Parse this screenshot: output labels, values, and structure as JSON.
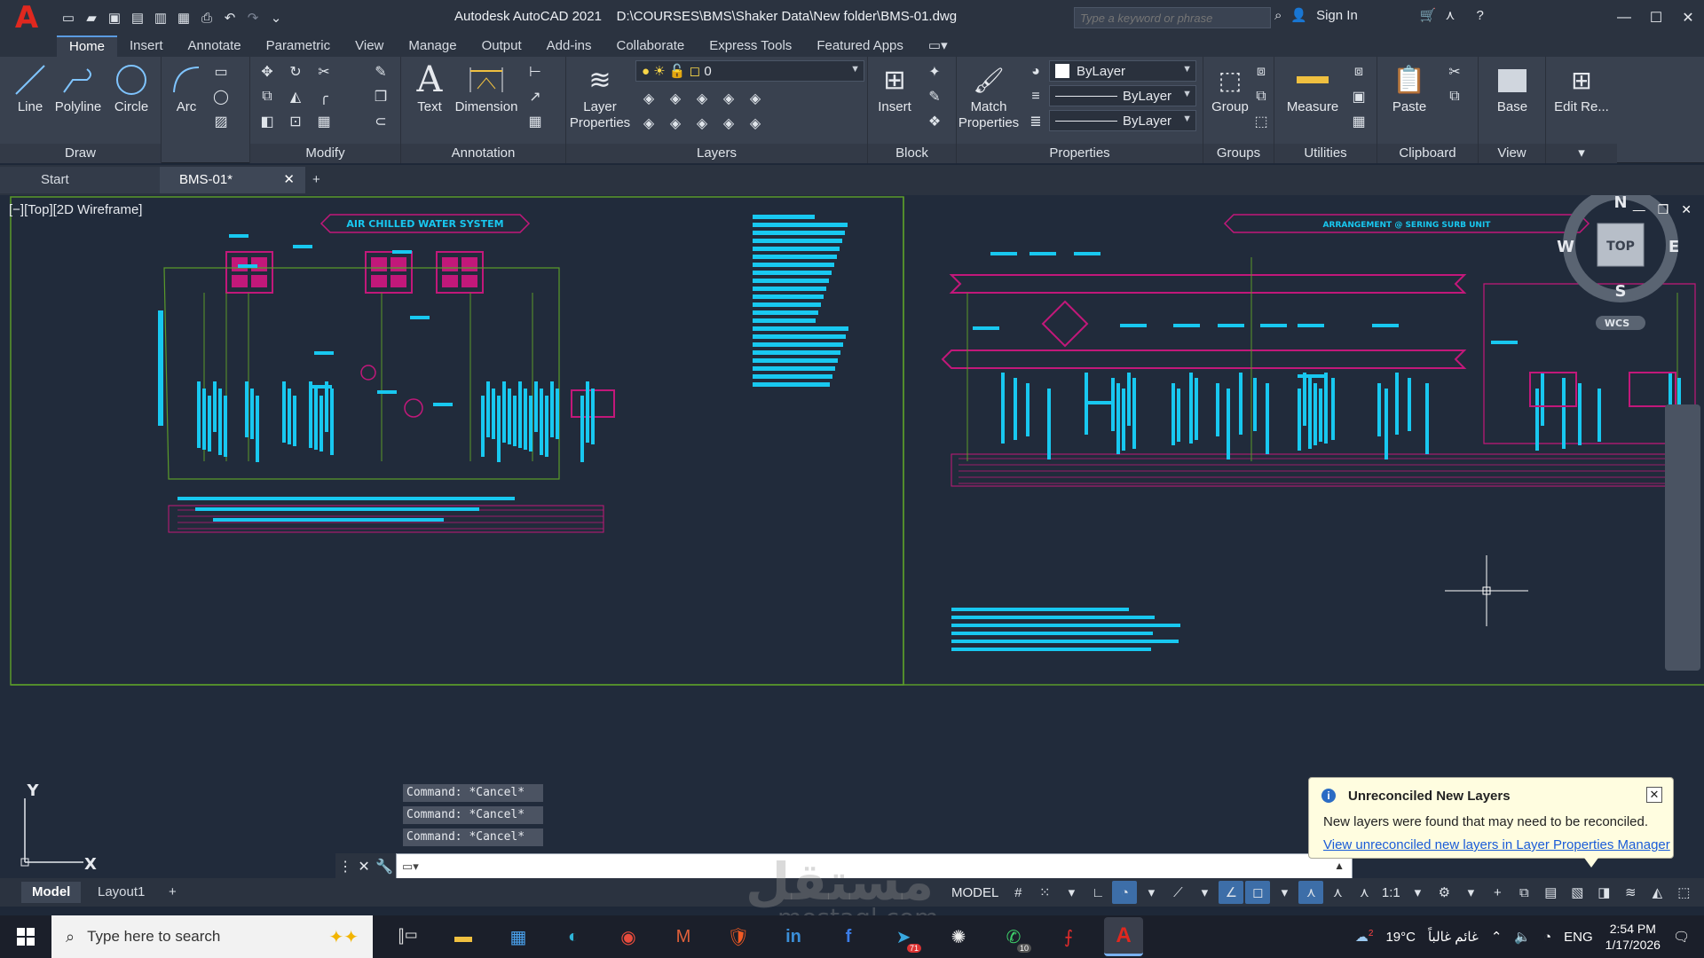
{
  "titlebar": {
    "app_title": "Autodesk AutoCAD 2021",
    "file_path": "D:\\COURSES\\BMS\\Shaker Data\\New folder\\BMS-01.dwg",
    "search_placeholder": "Type a keyword or phrase",
    "sign_in": "Sign In",
    "qat_icons": [
      "new-icon",
      "open-icon",
      "save-icon",
      "save-as-icon",
      "open-web-icon",
      "save-web-icon",
      "plot-icon",
      "undo-icon",
      "redo-icon"
    ]
  },
  "ribbon_tabs": [
    "Home",
    "Insert",
    "Annotate",
    "Parametric",
    "View",
    "Manage",
    "Output",
    "Add-ins",
    "Collaborate",
    "Express Tools",
    "Featured Apps"
  ],
  "ribbon": {
    "draw": {
      "title": "Draw",
      "tools": [
        "Line",
        "Polyline",
        "Circle",
        "Arc"
      ]
    },
    "modify": {
      "title": "Modify"
    },
    "annotation": {
      "title": "Annotation",
      "tools": [
        "Text",
        "Dimension"
      ]
    },
    "layers": {
      "title": "Layers",
      "tool": "Layer Properties",
      "current_layer": "0"
    },
    "block": {
      "title": "Block",
      "tool": "Insert"
    },
    "properties": {
      "title": "Properties",
      "tool": "Match Properties",
      "color": "ByLayer",
      "linetype": "ByLayer",
      "lineweight": "ByLayer"
    },
    "groups": {
      "title": "Groups",
      "tool": "Group"
    },
    "utilities": {
      "title": "Utilities",
      "tool": "Measure"
    },
    "clipboard": {
      "title": "Clipboard",
      "tool": "Paste"
    },
    "view": {
      "title": "View",
      "tool": "Base"
    },
    "edit_ref": {
      "tool": "Edit Re..."
    }
  },
  "file_tabs": {
    "start": "Start",
    "active": "BMS-01*"
  },
  "viewport": {
    "label": "[−][Top][2D Wireframe]",
    "left_title": "AIR CHILLED WATER SYSTEM",
    "right_title": "ARRANGEMENT @ SERING SURB UNIT",
    "viewcube": {
      "top": "TOP",
      "n": "N",
      "s": "S",
      "e": "E",
      "w": "W",
      "wcs": "WCS"
    },
    "ucs": {
      "x": "X",
      "y": "Y"
    }
  },
  "command": {
    "history": [
      "Command: *Cancel*",
      "Command: *Cancel*",
      "Command: *Cancel*"
    ],
    "input_value": ""
  },
  "notification": {
    "title": "Unreconciled New Layers",
    "message": "New layers were found that may need to be reconciled.",
    "link": "View unreconciled new layers in Layer Properties Manager"
  },
  "layout_tabs": [
    "Model",
    "Layout1"
  ],
  "status": {
    "model": "MODEL",
    "scale": "1:1"
  },
  "taskbar": {
    "search_placeholder": "Type here to search",
    "weather": "19°C",
    "weather_text": "غائم غالباً",
    "weather_badge": "2",
    "lang": "ENG",
    "time": "2:54 PM",
    "date": "1/17/2026",
    "telegram_badge": "71",
    "whatsapp_badge": "10"
  },
  "watermark": {
    "main": "مستقل",
    "sub": "mostaql.com"
  },
  "colors": {
    "cyan": "#18c8f0",
    "magenta": "#c2187a",
    "green": "#5a9a2a",
    "bg": "#212b3b"
  }
}
